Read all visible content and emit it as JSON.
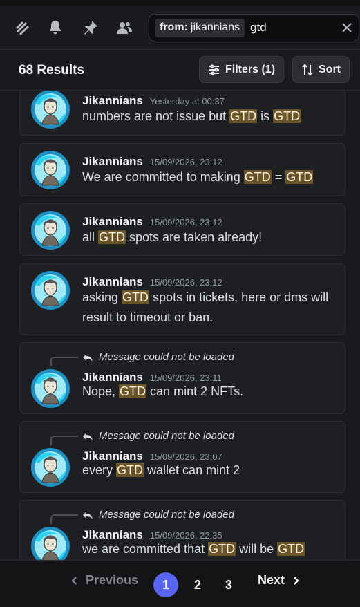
{
  "toolbar": {
    "icons": [
      "threads-icon",
      "bell-icon",
      "pin-icon",
      "members-icon"
    ],
    "search": {
      "chip_key": "from:",
      "chip_value": "jikannians",
      "query": "gtd"
    }
  },
  "header": {
    "results": "68 Results",
    "filters_label": "Filters (1)",
    "sort_label": "Sort"
  },
  "messages": [
    {
      "author": "Jikannians",
      "timestamp": "Yesterday at 00:37",
      "reply": null,
      "parts": [
        "numbers are not issue but ",
        "GTD",
        " is ",
        "GTD"
      ]
    },
    {
      "author": "Jikannians",
      "timestamp": "15/09/2026, 23:12",
      "reply": null,
      "parts": [
        "We are committed to making ",
        "GTD",
        " = ",
        "GTD"
      ]
    },
    {
      "author": "Jikannians",
      "timestamp": "15/09/2026, 23:12",
      "reply": null,
      "parts": [
        "all ",
        "GTD",
        " spots are taken already!"
      ]
    },
    {
      "author": "Jikannians",
      "timestamp": "15/09/2026, 23:12",
      "reply": null,
      "parts": [
        "asking ",
        "GTD",
        " spots in tickets, here or dms will result to timeout or ban."
      ]
    },
    {
      "author": "Jikannians",
      "timestamp": "15/09/2026, 23:11",
      "reply": "Message could not be loaded",
      "parts": [
        "Nope, ",
        "GTD",
        " can mint 2 NFTs."
      ]
    },
    {
      "author": "Jikannians",
      "timestamp": "15/09/2026, 23:07",
      "reply": "Message could not be loaded",
      "parts": [
        "every ",
        "GTD",
        " wallet can mint 2"
      ]
    },
    {
      "author": "Jikannians",
      "timestamp": "15/09/2026, 22:35",
      "reply": "Message could not be loaded",
      "parts": [
        "we are committed that ",
        "GTD",
        " will be ",
        "GTD"
      ]
    }
  ],
  "pagination": {
    "previous": "Previous",
    "pages": [
      "1",
      "2",
      "3"
    ],
    "current": "1",
    "next": "Next"
  },
  "colors": {
    "highlight": "#6b5427",
    "accent": "#5865f2",
    "card": "#1e1f22",
    "background": "#1a1a1e"
  }
}
